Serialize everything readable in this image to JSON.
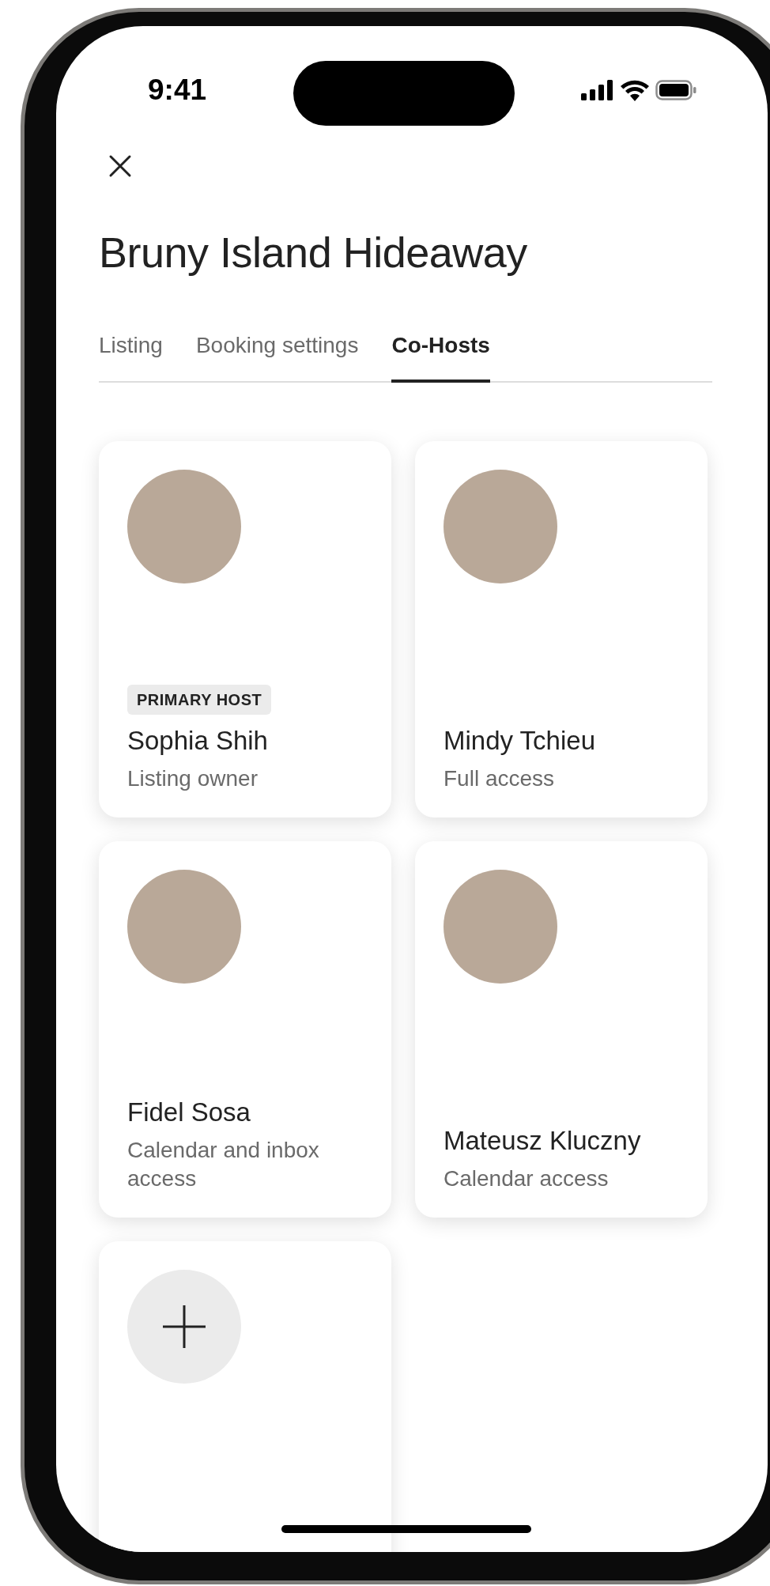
{
  "status_bar": {
    "time": "9:41"
  },
  "title": "Bruny Island Hideaway",
  "tabs": [
    {
      "label": "Listing",
      "selected": false
    },
    {
      "label": "Booking settings",
      "selected": false
    },
    {
      "label": "Co-Hosts",
      "selected": true
    }
  ],
  "cohosts": [
    {
      "badge": "PRIMARY HOST",
      "name": "Sophia Shih",
      "role": "Listing owner"
    },
    {
      "name": "Mindy Tchieu",
      "role": "Full access"
    },
    {
      "name": "Fidel Sosa",
      "role": "Calendar and inbox access"
    },
    {
      "name": "Mateusz Kluczny",
      "role": "Calendar access"
    }
  ]
}
